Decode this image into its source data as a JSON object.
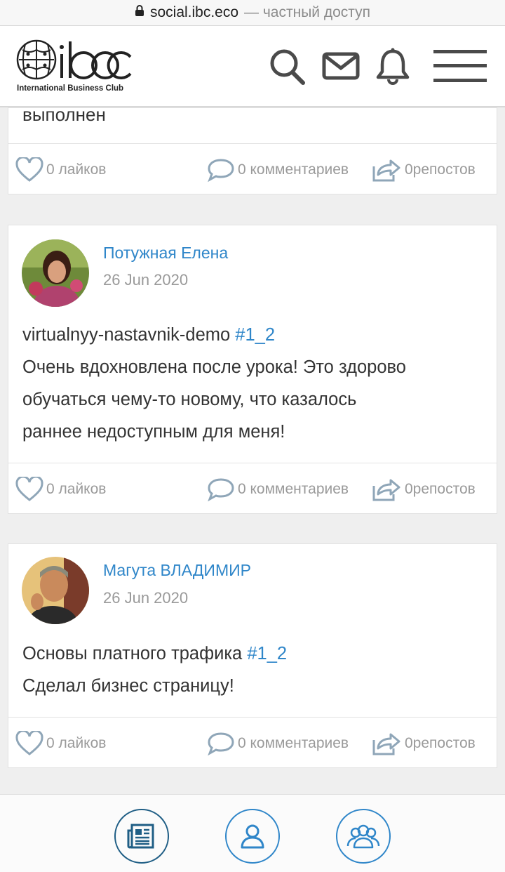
{
  "browser": {
    "host": "social.ibc.eco",
    "note": "— частный доступ"
  },
  "header": {
    "logo_text": "ibc",
    "tagline": "International Business Club"
  },
  "posts": [
    {
      "partial_text": "выполнен",
      "likes": "0 лайков",
      "comments": "0 комментариев",
      "reposts": "0репостов"
    },
    {
      "author": "Потужная Елена",
      "date": "26 Jun 2020",
      "line1_text": "virtualnyy-nastavnik-demo ",
      "line1_tag": "#1_2",
      "line2": "Очень вдохновлена после урока! Это здорово",
      "line3": "обучаться чему-то новому, что казалось",
      "line4": "раннее недоступным для меня!",
      "likes": "0 лайков",
      "comments": "0 комментариев",
      "reposts": "0репостов"
    },
    {
      "author": "Магута ВЛАДИМИР",
      "date": "26 Jun 2020",
      "line1_text": "Основы платного трафика ",
      "line1_tag": "#1_2",
      "line2": "Сделал бизнес страницу!",
      "likes": "0 лайков",
      "comments": "0 комментариев",
      "reposts": "0репостов"
    }
  ],
  "colors": {
    "link": "#2f86c9",
    "muted": "#9a9a9a",
    "icon": "#4a4a4a"
  },
  "icons": {
    "header": [
      "search-icon",
      "mail-icon",
      "bell-icon",
      "menu-icon"
    ],
    "bottom_nav": [
      "newspaper-icon",
      "user-icon",
      "users-icon"
    ]
  }
}
